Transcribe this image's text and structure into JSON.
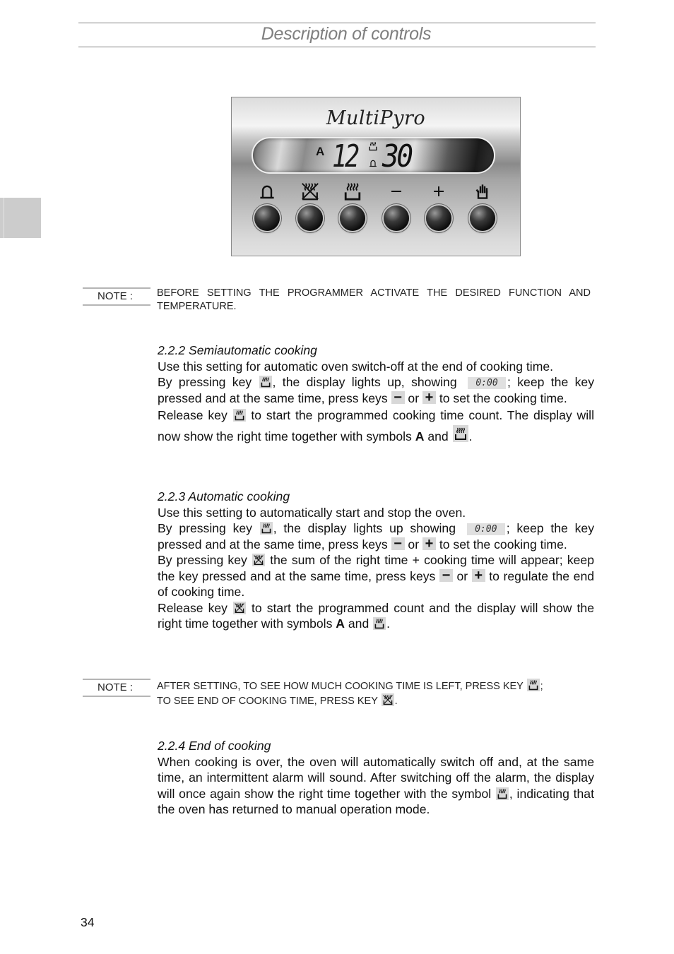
{
  "header": {
    "title": "Description of controls"
  },
  "panel": {
    "brand": "MultiPyro",
    "display": {
      "auto_indicator": "A",
      "hours": "12",
      "minutes": "30",
      "icons": [
        "cooking-icon",
        "bell-icon"
      ]
    },
    "keys": [
      {
        "id": "alarm",
        "icon": "bell-icon",
        "label": "Alarm"
      },
      {
        "id": "end-of-cooking",
        "icon": "end-cooking-icon",
        "label": "End of cooking"
      },
      {
        "id": "cooking-time",
        "icon": "cooking-icon",
        "label": "Cooking time"
      },
      {
        "id": "minus",
        "icon": "minus-icon",
        "label": "−"
      },
      {
        "id": "plus",
        "icon": "plus-icon",
        "label": "+"
      },
      {
        "id": "manual",
        "icon": "hand-icon",
        "label": "Manual"
      }
    ]
  },
  "notes": [
    {
      "label": "NOTE :",
      "text": "BEFORE SETTING THE PROGRAMMER ACTIVATE THE DESIRED FUNCTION AND TEMPERATURE."
    },
    {
      "label": "NOTE :",
      "line1_a": "AFTER SETTING, TO SEE HOW MUCH COOKING TIME IS LEFT, PRESS KEY ",
      "line1_b": ";",
      "line2_a": "TO SEE END OF COOKING TIME, PRESS KEY ",
      "line2_b": "."
    }
  ],
  "sections": {
    "semiautomatic": {
      "heading": "2.2.2 Semiautomatic cooking",
      "p1": "Use this setting for automatic oven switch-off at the end of cooking time.",
      "p2_a": "By pressing key ",
      "p2_b": ", the display lights up, showing ",
      "p2_c": "; keep the key pressed and at the same time, press keys ",
      "p2_d": " or ",
      "p2_e": " to set the cooking time.",
      "p3_a": "Release key ",
      "p3_b": " to start the programmed cooking time count. The display will now show the right time together with symbols ",
      "p3_bold": "A",
      "p3_c": " and ",
      "p3_d": "."
    },
    "automatic": {
      "heading": "2.2.3 Automatic cooking",
      "p1": "Use this setting to automatically start and stop the oven.",
      "p2_a": "By pressing key ",
      "p2_b": ", the display lights up showing ",
      "p2_c": "; keep the key pressed and at the same time, press keys ",
      "p2_d": " or ",
      "p2_e": " to set the cooking time.",
      "p3_a": "By pressing key ",
      "p3_b": " the sum of the right time + cooking time will appear; keep the key pressed and at the same time, press keys ",
      "p3_c": " or ",
      "p3_d": " to regulate the end of cooking time.",
      "p4_a": "Release key ",
      "p4_b": " to start the programmed count and the display will show the right time together with symbols ",
      "p4_bold": "A",
      "p4_c": " and ",
      "p4_d": "."
    },
    "end": {
      "heading": "2.2.4 End of cooking",
      "p1_a": "When cooking is over, the oven will automatically switch off and, at the same time, an intermittent alarm will sound. After switching off the alarm, the display will once again show the right time together with the symbol ",
      "p1_b": ", indicating that the oven has returned to manual operation mode."
    }
  },
  "inline": {
    "lcd_value": "0:00",
    "minus_key": "−",
    "plus_key": "+"
  },
  "footer": {
    "page_number": "34"
  }
}
